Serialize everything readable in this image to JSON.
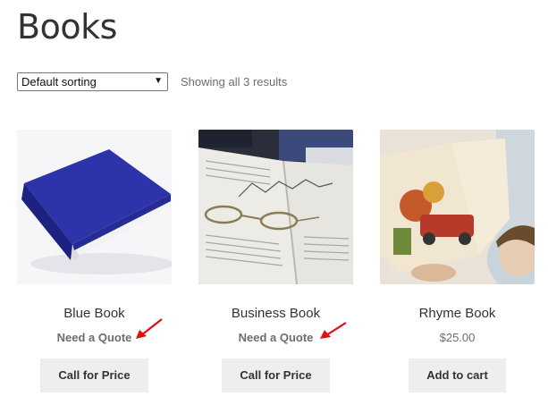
{
  "page": {
    "title": "Books"
  },
  "toolbar": {
    "sort_selected": "Default sorting",
    "result_count": "Showing all 3 results"
  },
  "products": [
    {
      "title": "Blue Book",
      "price": "Need a Quote",
      "button": "Call for Price",
      "image": "blue-book-image"
    },
    {
      "title": "Business Book",
      "price": "Need a Quote",
      "button": "Call for Price",
      "image": "open-business-book-image"
    },
    {
      "title": "Rhyme Book",
      "price": "$25.00",
      "button": "Add to cart",
      "image": "child-reading-picture-book-image"
    }
  ],
  "colors": {
    "arrow": "#e01010",
    "button_bg": "#eeeeee",
    "book_blue": "#2b2f9e"
  }
}
